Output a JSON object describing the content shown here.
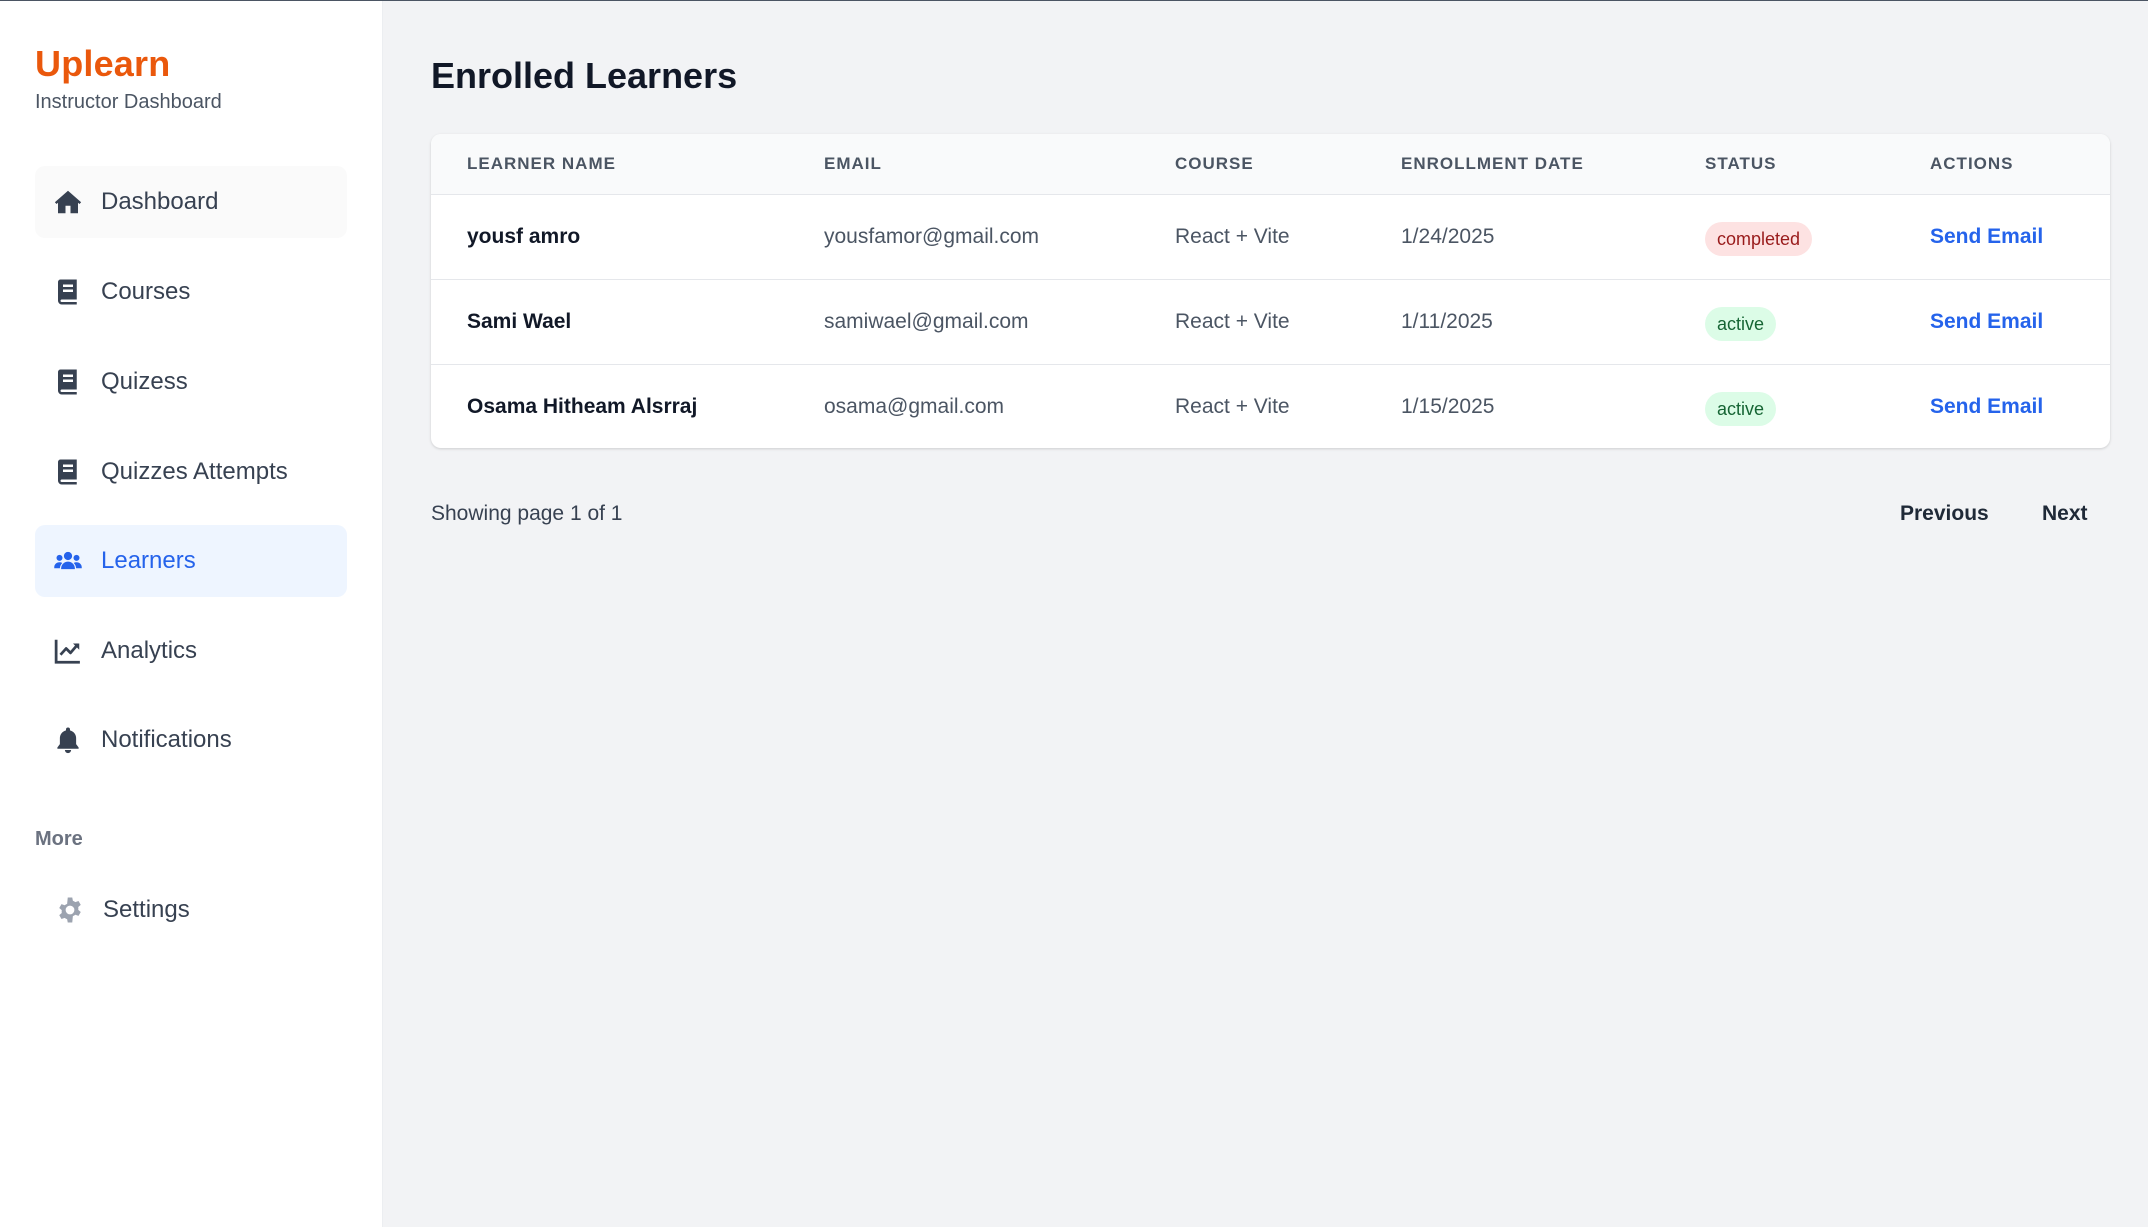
{
  "sidebar": {
    "brand": "Uplearn",
    "subtitle": "Instructor Dashboard",
    "items": [
      {
        "label": "Dashboard",
        "icon": "home-icon"
      },
      {
        "label": "Courses",
        "icon": "book-icon"
      },
      {
        "label": "Quizess",
        "icon": "book-icon"
      },
      {
        "label": "Quizzes Attempts",
        "icon": "book-icon"
      },
      {
        "label": "Learners",
        "icon": "users-icon",
        "active": true
      },
      {
        "label": "Analytics",
        "icon": "chart-line-icon"
      },
      {
        "label": "Notifications",
        "icon": "bell-icon"
      }
    ],
    "more_label": "More",
    "settings": {
      "label": "Settings",
      "icon": "gear-icon"
    }
  },
  "main": {
    "title": "Enrolled Learners",
    "columns": [
      "Learner Name",
      "Email",
      "Course",
      "Enrollment Date",
      "Status",
      "Actions"
    ],
    "rows": [
      {
        "name": "yousf amro",
        "email": "yousfamor@gmail.com",
        "course": "React + Vite",
        "date": "1/24/2025",
        "status": "completed",
        "action": "Send Email"
      },
      {
        "name": "Sami Wael",
        "email": "samiwael@gmail.com",
        "course": "React + Vite",
        "date": "1/11/2025",
        "status": "active",
        "action": "Send Email"
      },
      {
        "name": "Osama Hitheam Alsrraj",
        "email": "osama@gmail.com",
        "course": "React + Vite",
        "date": "1/15/2025",
        "status": "active",
        "action": "Send Email"
      }
    ],
    "pagination": {
      "text": "Showing page 1 of 1",
      "previous": "Previous",
      "next": "Next"
    }
  },
  "colors": {
    "brand": "#ea580c",
    "accent": "#2563eb",
    "completed_bg": "#fde2e2",
    "active_bg": "#dcfce7"
  }
}
